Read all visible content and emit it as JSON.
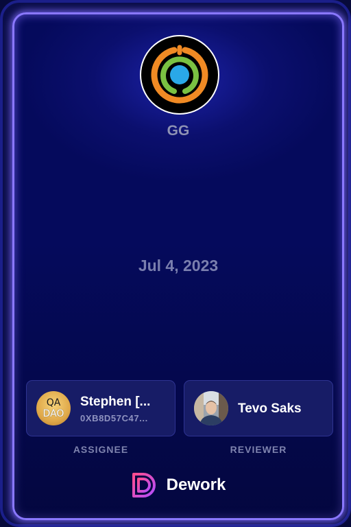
{
  "organization": {
    "name": "GG",
    "logo_icon": "gg-rings-logo-icon",
    "colors": {
      "outer_ring": "#f08a24",
      "middle_ring": "#7ac142",
      "center_dot": "#2aa8e8"
    }
  },
  "date": "Jul 4, 2023",
  "assignee": {
    "name": "Stephen [...",
    "address": "0XB8D57C47...",
    "avatar": {
      "top_text": "QA",
      "bottom_text": "DAO"
    },
    "role_label": "ASSIGNEE"
  },
  "reviewer": {
    "name": "Tevo Saks",
    "avatar_icon": "person-photo-avatar",
    "role_label": "REVIEWER"
  },
  "brand": {
    "name": "Dework",
    "icon": "dework-logo-icon",
    "colors": {
      "gradient_start": "#ff4d8d",
      "gradient_end": "#b34dff"
    }
  },
  "theme": {
    "card_border": "#8a78ff",
    "background": "#0b0f6e"
  }
}
